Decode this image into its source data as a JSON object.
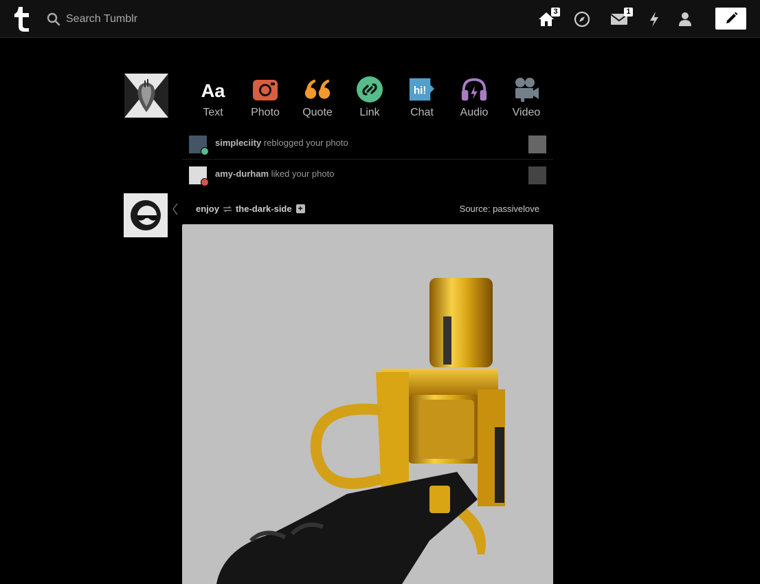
{
  "header": {
    "search_placeholder": "Search Tumblr",
    "home_badge": "3",
    "inbox_badge": "1"
  },
  "post_types": [
    {
      "label": "Text",
      "color": "#ffffff"
    },
    {
      "label": "Photo",
      "color": "#d95e40"
    },
    {
      "label": "Quote",
      "color": "#f2992e"
    },
    {
      "label": "Link",
      "color": "#56bc8a"
    },
    {
      "label": "Chat",
      "color": "#529ecc"
    },
    {
      "label": "Audio",
      "color": "#a77dc2"
    },
    {
      "label": "Video",
      "color": "#748089"
    }
  ],
  "activity": [
    {
      "user": "simpleciity",
      "action": "reblogged your photo"
    },
    {
      "user": "amy-durham",
      "action": "liked your photo"
    }
  ],
  "post": {
    "blog": "enjoy",
    "reblogged_from": "the-dark-side",
    "source": "Source: passivelove"
  },
  "colors": {
    "background": "#000000",
    "header": "#111111",
    "photo_bg": "#c0c0c0",
    "gold": "#d4a017"
  }
}
